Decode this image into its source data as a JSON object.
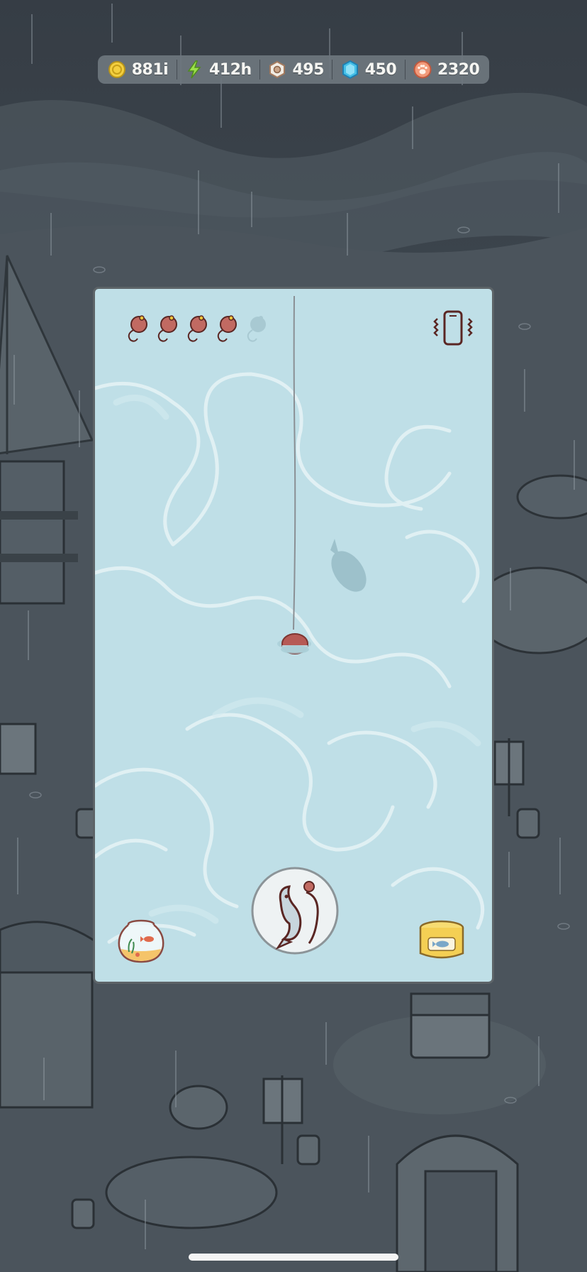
{
  "currencies": {
    "coins": {
      "value": "881i",
      "icon": "coin-icon"
    },
    "energy": {
      "value": "412h",
      "icon": "lightning-icon"
    },
    "nuts": {
      "value": "495",
      "icon": "hex-nut-icon"
    },
    "gems": {
      "value": "450",
      "icon": "blue-gem-icon"
    },
    "paws": {
      "value": "2320",
      "icon": "paw-token-icon"
    }
  },
  "fishing": {
    "bait_total": 5,
    "bait_remaining": 4,
    "bait_icon": "fishing-bobber-icon",
    "vibrate_icon": "phone-vibrate-icon",
    "fishbowl_icon": "fishbowl-icon",
    "catch_icon": "reel-fish-icon",
    "tackle_icon": "bait-tin-icon"
  },
  "colors": {
    "water": "#bfdfe7",
    "bobber": "#b65a55",
    "panel_border": "#5d6468",
    "background": "#3f4850"
  }
}
